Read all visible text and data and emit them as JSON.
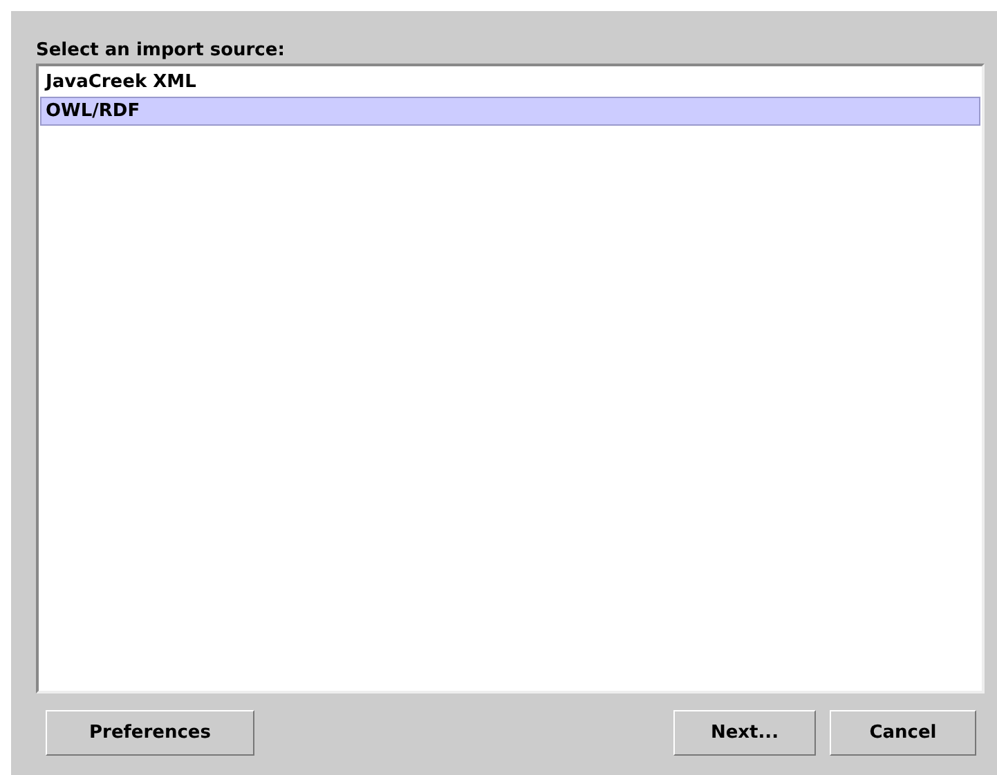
{
  "label": "Select an import source:",
  "sources": [
    {
      "label": "JavaCreek XML",
      "selected": false
    },
    {
      "label": "OWL/RDF",
      "selected": true
    }
  ],
  "buttons": {
    "left": [
      "Preferences"
    ],
    "right": [
      "Next...",
      "Cancel"
    ]
  }
}
